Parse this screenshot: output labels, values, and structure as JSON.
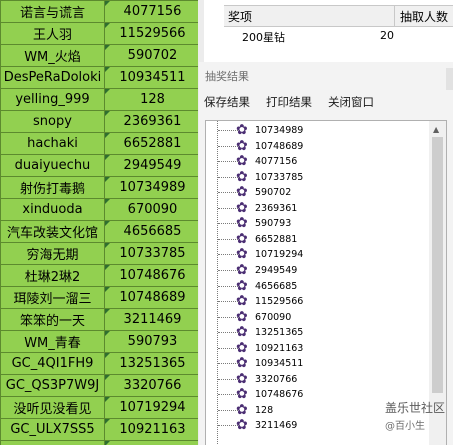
{
  "sheet": {
    "rows": [
      {
        "name": "诺言与谎言",
        "value": "4077156"
      },
      {
        "name": "王人羽",
        "value": "11529566"
      },
      {
        "name": "WM_火焰",
        "value": "590702"
      },
      {
        "name": "DesPeRaDoloki",
        "value": "10934511"
      },
      {
        "name": "yelling_999",
        "value": "128"
      },
      {
        "name": "snopy",
        "value": "2369361"
      },
      {
        "name": "hachaki",
        "value": "6652881"
      },
      {
        "name": "duaiyuechu",
        "value": "2949549"
      },
      {
        "name": "射伤打毒鹅",
        "value": "10734989"
      },
      {
        "name": "xinduoda",
        "value": "670090"
      },
      {
        "name": "汽车改装文化馆",
        "value": "4656685"
      },
      {
        "name": "穷海无期",
        "value": "10733785"
      },
      {
        "name": "杜琳2琳2",
        "value": "10748676"
      },
      {
        "name": "珥陵刘一溜三",
        "value": "10748689"
      },
      {
        "name": "笨笨的一天",
        "value": "3211469"
      },
      {
        "name": "WM_青春",
        "value": "590793"
      },
      {
        "name": "GC_4QI1FH9",
        "value": "13251365"
      },
      {
        "name": "GC_QS3P7W9J",
        "value": "3320766"
      },
      {
        "name": "没听见没看见",
        "value": "10719294"
      },
      {
        "name": "GC_ULX7SS5",
        "value": "10921163"
      },
      {
        "name": "",
        "value": ""
      }
    ]
  },
  "prize_table": {
    "col_prize": "奖项",
    "col_count": "抽取人数",
    "row_prize": "200星钻",
    "row_count": "20"
  },
  "dialog": {
    "title": "抽奖结果",
    "menu_save": "保存结果",
    "menu_print": "打印结果",
    "menu_close": "关闭窗口",
    "results": [
      "10734989",
      "10748689",
      "4077156",
      "10733785",
      "590702",
      "2369361",
      "590793",
      "6652881",
      "10719294",
      "2949549",
      "4656685",
      "11529566",
      "670090",
      "13251365",
      "10921163",
      "10934511",
      "3320766",
      "10748676",
      "128",
      "3211469"
    ]
  },
  "icons": {
    "tree_node": "flower-icon",
    "scroll_up": "arrow-up-icon"
  },
  "watermark": {
    "site": "盖乐世社区",
    "author": "@百小生"
  },
  "colors": {
    "sheet_bg": "#92d050",
    "dialog_bg": "#f3f3f3",
    "node_icon": "#4b2e73"
  }
}
